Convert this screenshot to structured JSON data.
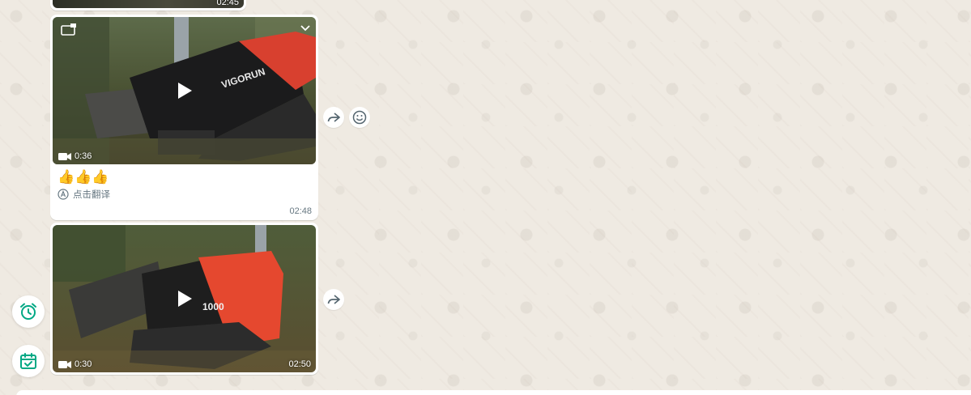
{
  "colors": {
    "wallpaper": "#efeae2",
    "bubble": "#ffffff",
    "accent": "#00a884",
    "muted": "#667781"
  },
  "messages": [
    {
      "time": "02:45"
    },
    {
      "duration": "0:36",
      "caption": "👍👍👍",
      "translate_label": "点击翻译",
      "time": "02:48"
    },
    {
      "duration": "0:30",
      "time": "02:50"
    }
  ],
  "icons": {
    "forward": "forward-icon",
    "react": "emoji-icon",
    "alarm": "alarm-icon",
    "calendar": "calendar-icon",
    "video": "video-camera-icon",
    "play": "play-icon"
  }
}
